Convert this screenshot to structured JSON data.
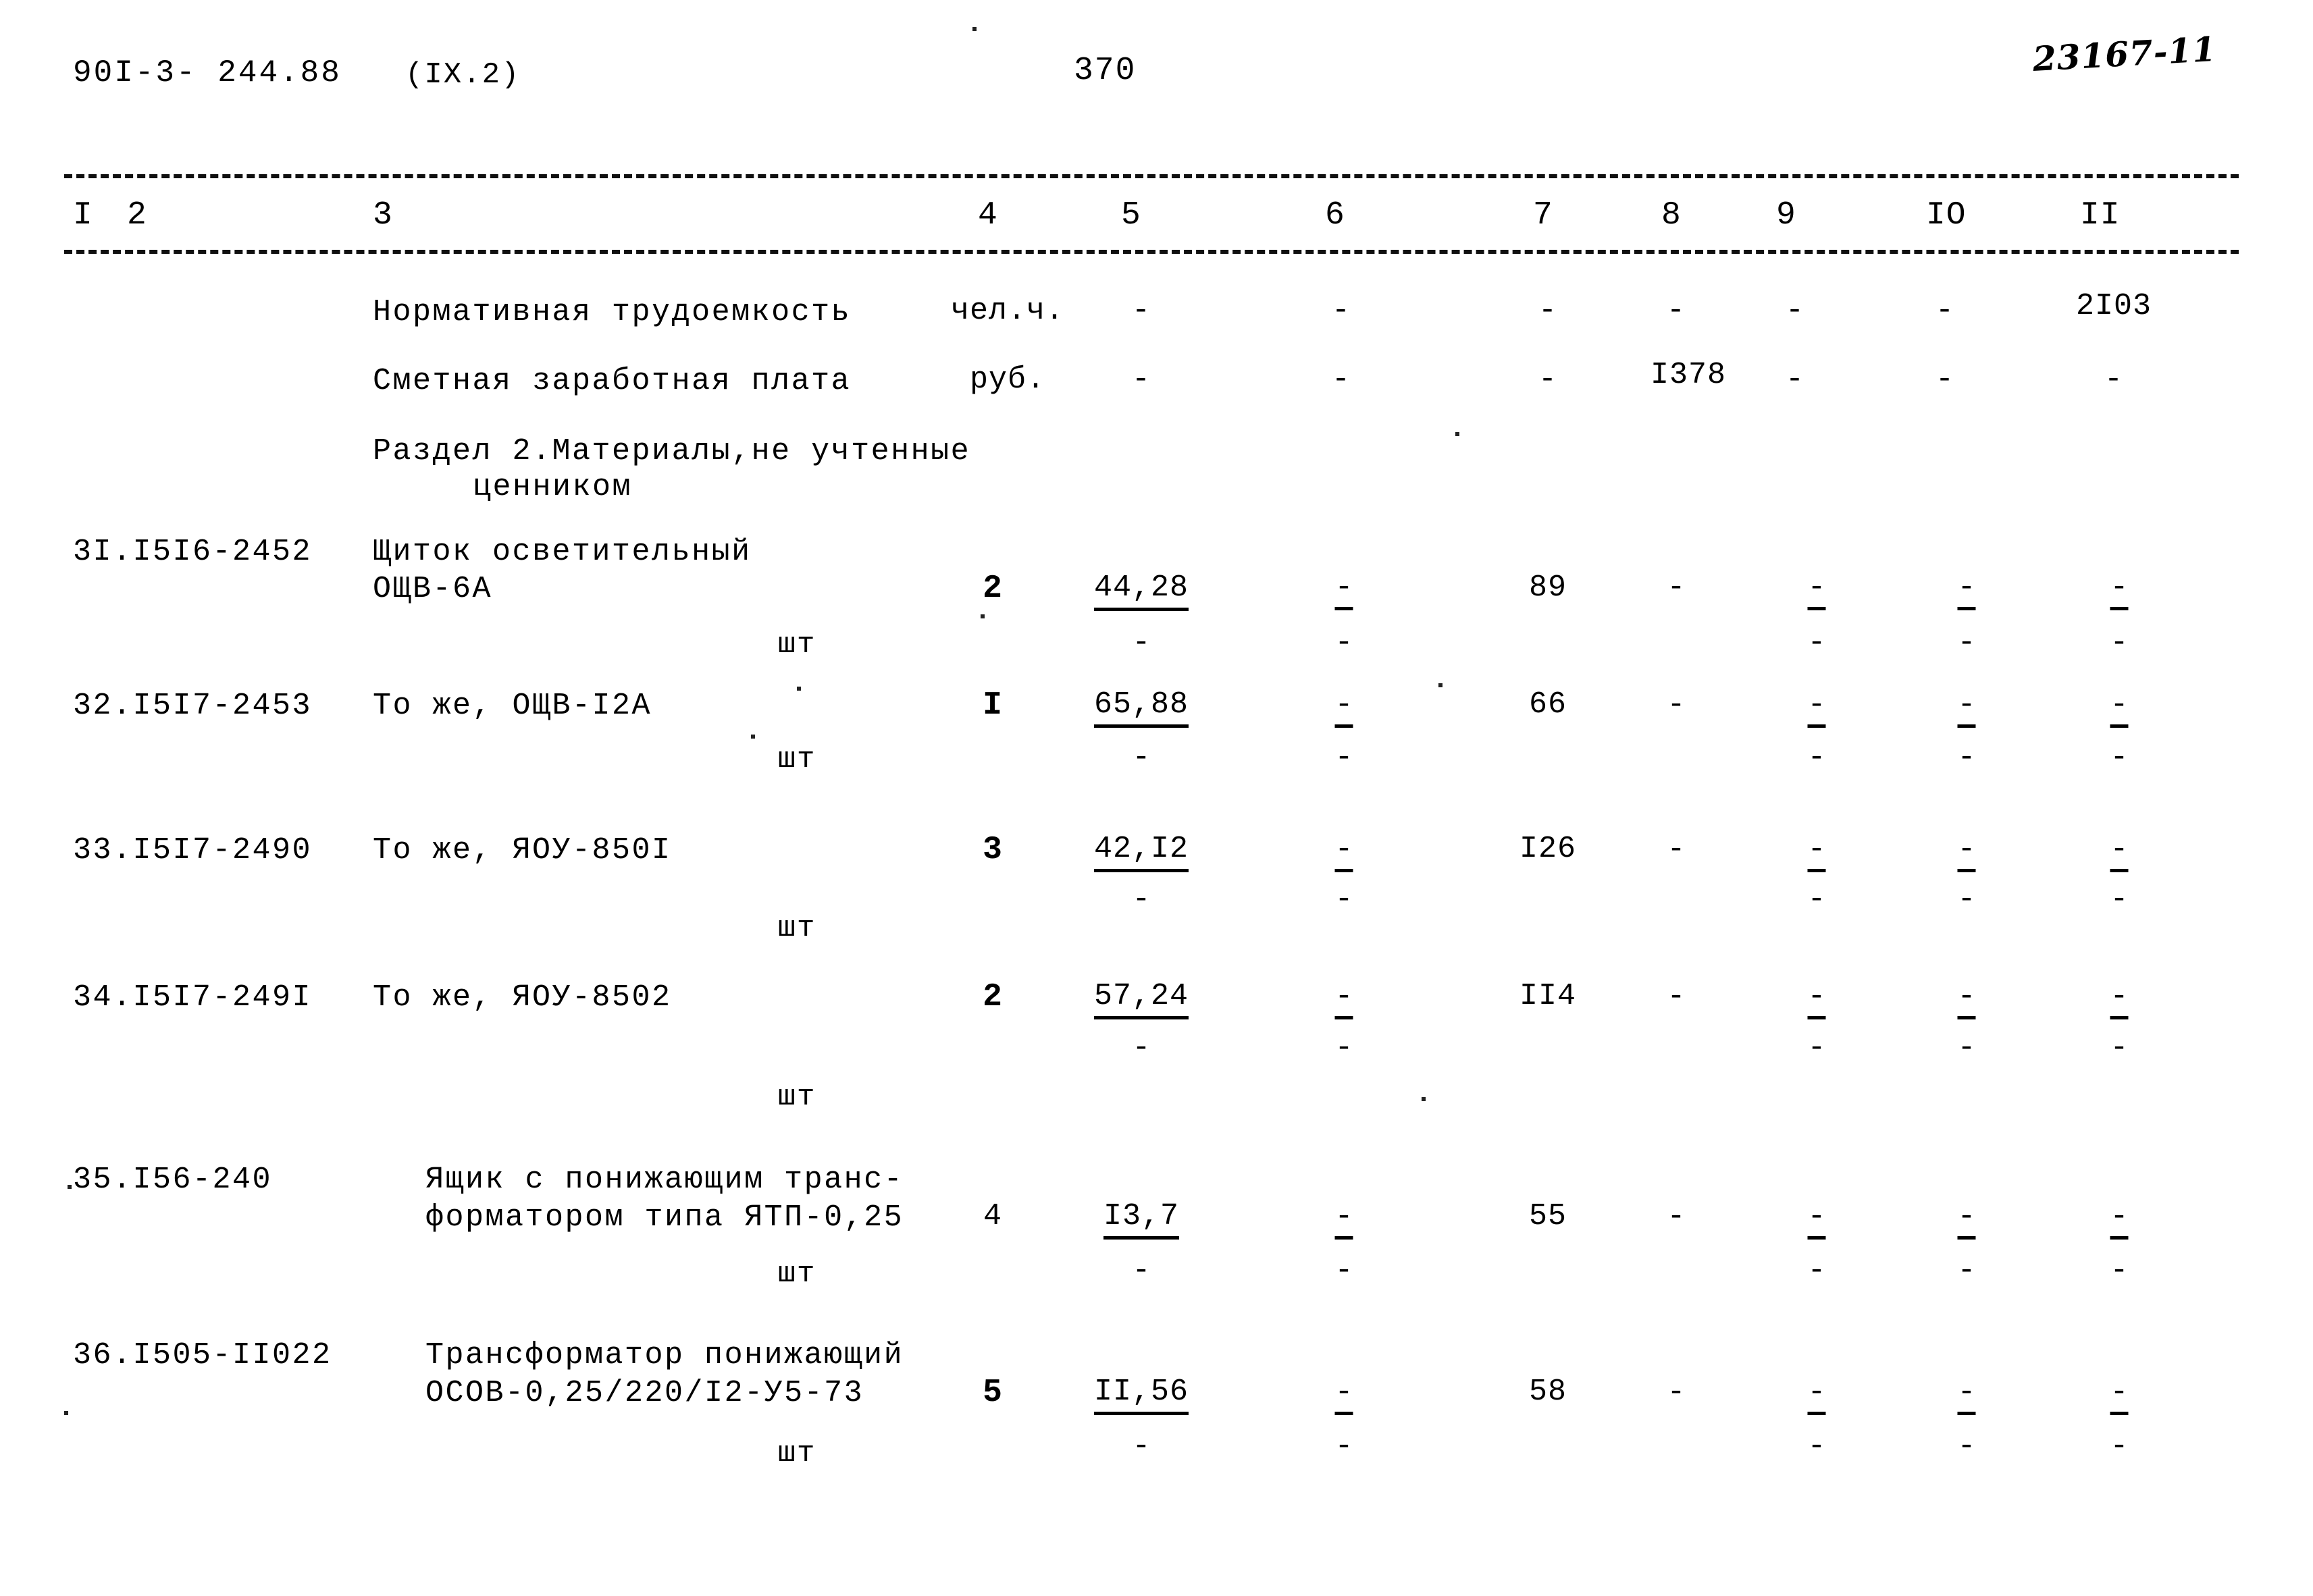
{
  "header": {
    "doc_code": "90I-3- 244.88",
    "section_ref": "(IX.2)",
    "page_number": "370",
    "stamp_number": "23167-11"
  },
  "table": {
    "column_headers": [
      "I",
      "2",
      "3",
      "4",
      "5",
      "6",
      "7",
      "8",
      "9",
      "IO",
      "II"
    ],
    "section_title_line1": "Раздел 2.Материалы,не учтенные",
    "section_title_line2": "ценником",
    "summary_rows": [
      {
        "name": "Нормативная трудоемкость",
        "unit": "чел.ч.",
        "c5": "-",
        "c6": "-",
        "c7": "-",
        "c8": "-",
        "c9": "-",
        "c10": "-",
        "c11": "2I03"
      },
      {
        "name": "Сметная заработная плата",
        "unit": "руб.",
        "c5": "-",
        "c6": "-",
        "c7": "-",
        "c8": "I378",
        "c9": "-",
        "c10": "-",
        "c11": "-"
      }
    ],
    "item_rows": [
      {
        "code": "3I.I5I6-2452",
        "name_line1": "Щиток осветительный",
        "name_line2": "ОЩВ-6А",
        "qty": "2",
        "unit": "шт",
        "c5": "44,28",
        "c6": "-",
        "c7": "89",
        "c8": "-",
        "c9": "-",
        "c10": "-",
        "c11": "-",
        "c5b": "-",
        "c6b": "-",
        "c9b": "-",
        "c10b": "-",
        "c11b": "-"
      },
      {
        "code": "32.I5I7-2453",
        "name_line1": "То же, ОЩВ-I2А",
        "name_line2": "",
        "qty": "I",
        "unit": "шт",
        "c5": "65,88",
        "c6": "-",
        "c7": "66",
        "c8": "-",
        "c9": "-",
        "c10": "-",
        "c11": "-",
        "c5b": "-",
        "c6b": "-",
        "c9b": "-",
        "c10b": "-",
        "c11b": "-"
      },
      {
        "code": "33.I5I7-2490",
        "name_line1": "То же, ЯОУ-850I",
        "name_line2": "",
        "qty": "3",
        "unit": "шт",
        "c5": "42,I2",
        "c6": "-",
        "c7": "I26",
        "c8": "-",
        "c9": "-",
        "c10": "-",
        "c11": "-",
        "c5b": "-",
        "c6b": "-",
        "c9b": "-",
        "c10b": "-",
        "c11b": "-"
      },
      {
        "code": "34.I5I7-249I",
        "name_line1": "То же, ЯОУ-8502",
        "name_line2": "",
        "qty": "2",
        "unit": "шт",
        "c5": "57,24",
        "c6": "-",
        "c7": "II4",
        "c8": "-",
        "c9": "-",
        "c10": "-",
        "c11": "-",
        "c5b": "-",
        "c6b": "-",
        "c9b": "-",
        "c10b": "-",
        "c11b": "-"
      },
      {
        "code": "35.I56-240",
        "name_line1": "Ящик с понижающим транс-",
        "name_line2": "форматором типа ЯТП-0,25",
        "qty": "4",
        "unit": "шт",
        "c5": "I3,7",
        "c6": "-",
        "c7": "55",
        "c8": "-",
        "c9": "-",
        "c10": "-",
        "c11": "-",
        "c5b": "-",
        "c6b": "-",
        "c9b": "-",
        "c10b": "-",
        "c11b": "-"
      },
      {
        "code": "36.I505-II022",
        "name_line1": "Трансформатор понижающий",
        "name_line2": "ОСОВ-0,25/220/I2-У5-73",
        "qty": "5",
        "unit": "шт",
        "c5": "II,56",
        "c6": "-",
        "c7": "58",
        "c8": "-",
        "c9": "-",
        "c10": "-",
        "c11": "-",
        "c5b": "-",
        "c6b": "-",
        "c9b": "-",
        "c10b": "-",
        "c11b": "-"
      }
    ]
  }
}
